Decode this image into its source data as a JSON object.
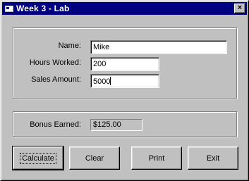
{
  "window": {
    "title": "Week 3 - Lab",
    "close_glyph": "×"
  },
  "form": {
    "name_label": "Name:",
    "name_value": "Mike",
    "hours_label": "Hours Worked:",
    "hours_value": "200",
    "sales_label": "Sales Amount:",
    "sales_value": "5000"
  },
  "bonus": {
    "label": "Bonus Earned:",
    "value": "$125.00"
  },
  "buttons": {
    "calculate": "Calculate",
    "clear": "Clear",
    "print": "Print",
    "exit": "Exit"
  }
}
